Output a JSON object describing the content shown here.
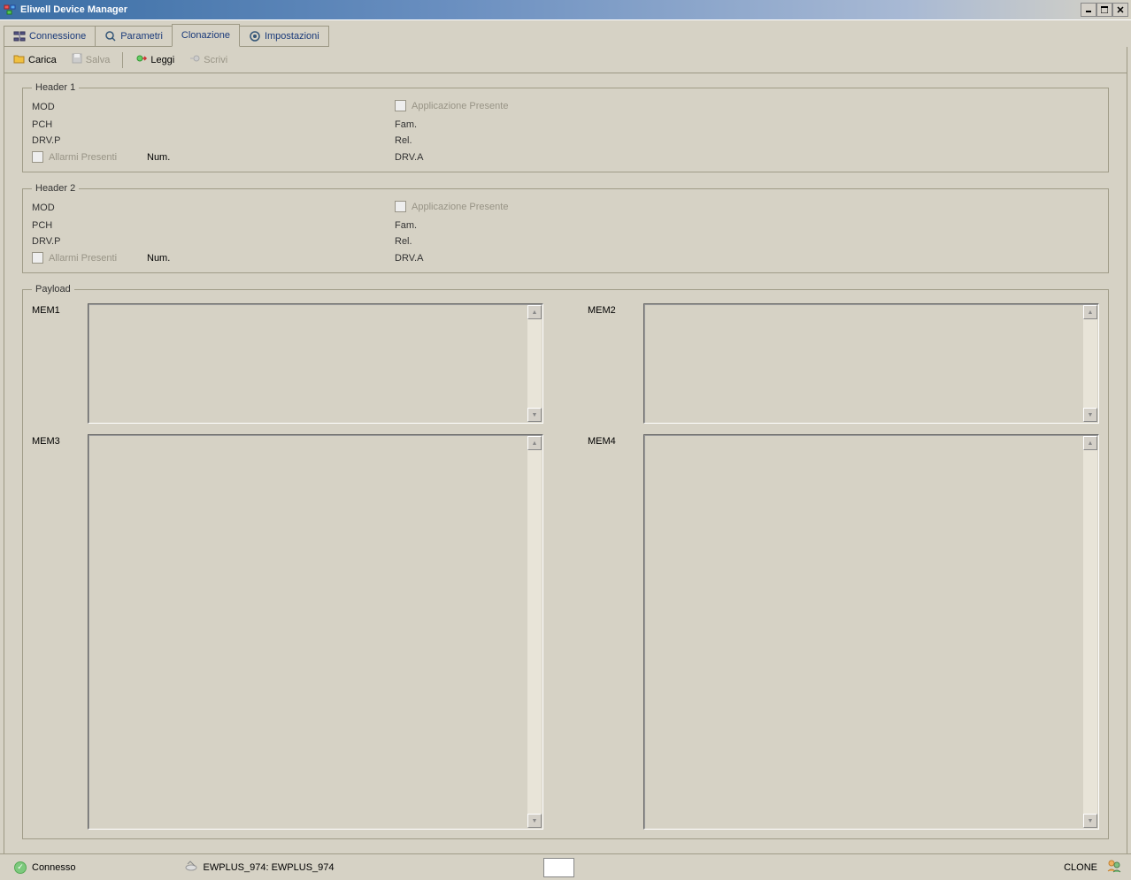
{
  "title": "Eliwell Device Manager",
  "tabs": {
    "connessione": "Connessione",
    "parametri": "Parametri",
    "clonazione": "Clonazione",
    "impostazioni": "Impostazioni"
  },
  "toolbar": {
    "carica": "Carica",
    "salva": "Salva",
    "leggi": "Leggi",
    "scrivi": "Scrivi"
  },
  "header1": {
    "legend": "Header 1",
    "mod": "MOD",
    "pch": "PCH",
    "drvp": "DRV.P",
    "allarmi": "Allarmi Presenti",
    "num": "Num.",
    "app_presente": "Applicazione Presente",
    "fam": "Fam.",
    "rel": "Rel.",
    "drva": "DRV.A"
  },
  "header2": {
    "legend": "Header 2",
    "mod": "MOD",
    "pch": "PCH",
    "drvp": "DRV.P",
    "allarmi": "Allarmi Presenti",
    "num": "Num.",
    "app_presente": "Applicazione Presente",
    "fam": "Fam.",
    "rel": "Rel.",
    "drva": "DRV.A"
  },
  "payload": {
    "legend": "Payload",
    "mem1": "MEM1",
    "mem2": "MEM2",
    "mem3": "MEM3",
    "mem4": "MEM4"
  },
  "status": {
    "connesso": "Connesso",
    "device": "EWPLUS_974: EWPLUS_974",
    "clone": "CLONE"
  }
}
